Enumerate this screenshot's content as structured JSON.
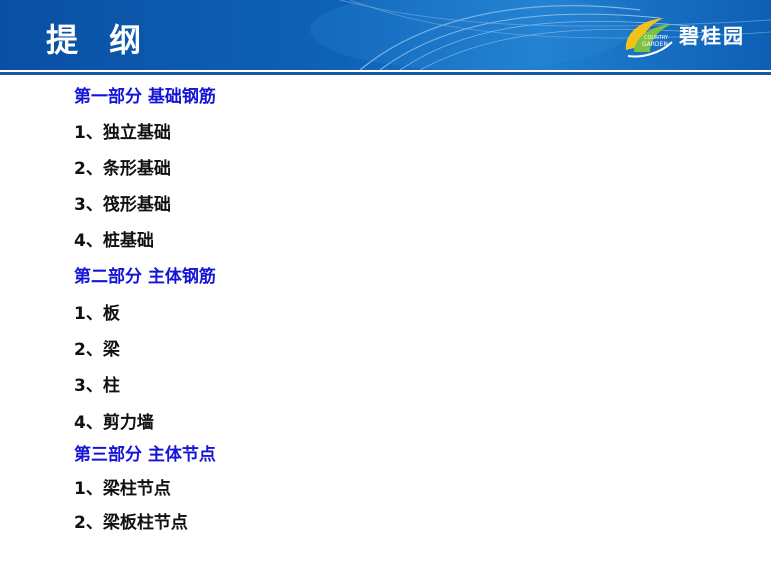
{
  "header": {
    "title": "提 纲",
    "logo_cn": "碧桂园",
    "logo_en_small": "COUNTRY",
    "logo_en": "GARDEN",
    "colors": {
      "bar": "#0e63b8",
      "rule": "#1a56a8",
      "logo_accent": "#f2c21b"
    },
    "logo_icon": "phoenix-swoosh-icon"
  },
  "outline": {
    "part1": {
      "title": "第一部分 基础钢筋",
      "items": [
        "1、独立基础",
        "2、条形基础",
        "3、筏形基础",
        "4、桩基础"
      ]
    },
    "part2": {
      "title": "第二部分 主体钢筋",
      "items": [
        "1、板",
        "2、梁",
        "3、柱",
        "4、剪力墙"
      ]
    },
    "part3": {
      "title": "第三部分 主体节点",
      "items": [
        "1、梁柱节点",
        "2、梁板柱节点"
      ]
    },
    "colors": {
      "section": "#1515d8",
      "item": "#111111"
    }
  }
}
